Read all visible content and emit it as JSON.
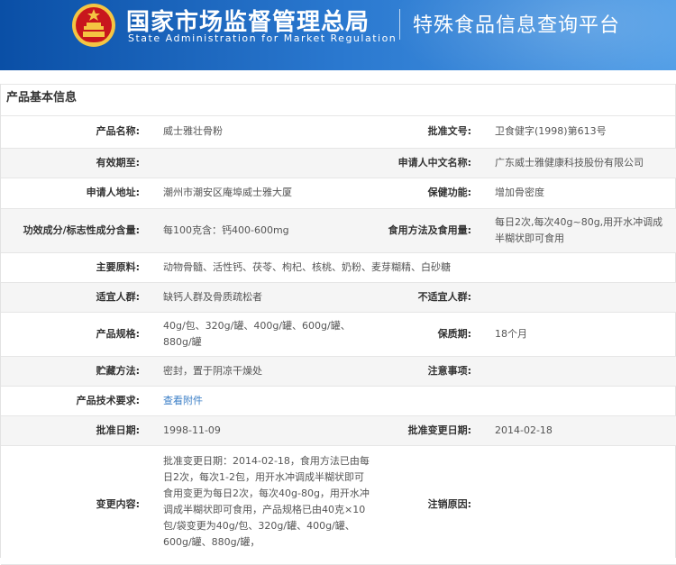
{
  "header": {
    "org_cn": "国家市场监督管理总局",
    "org_en": "State Administration  for Market Regulation",
    "platform": "特殊食品信息查询平台",
    "colors": {
      "banner_start": "#0a4fa6",
      "banner_end": "#4c9be6",
      "emblem_red": "#c8161d",
      "emblem_gold": "#f4c542"
    }
  },
  "section": {
    "title": "产品基本信息"
  },
  "rows": [
    {
      "l1": "产品名称:",
      "v1": "威士雅壮骨粉",
      "l2": "批准文号:",
      "v2": "卫食健字(1998)第613号"
    },
    {
      "l1": "有效期至:",
      "v1": "",
      "l2": "申请人中文名称:",
      "v2": "广东威士雅健康科技股份有限公司"
    },
    {
      "l1": "申请人地址:",
      "v1": "潮州市潮安区庵埠威士雅大厦",
      "l2": "保健功能:",
      "v2": "增加骨密度"
    },
    {
      "l1": "功效成分/标志性成分含量:",
      "v1": "每100克含：钙400-600mg",
      "l2": "食用方法及食用量:",
      "v2": "每日2次,每次40g~80g,用开水冲调成半糊状即可食用"
    },
    {
      "l1": "主要原料:",
      "v1": "动物骨髓、活性钙、茯苓、枸杞、核桃、奶粉、麦芽糊精、白砂糖"
    },
    {
      "l1": "适宜人群:",
      "v1": "缺钙人群及骨质疏松者",
      "l2": "不适宜人群:",
      "v2": ""
    },
    {
      "l1": "产品规格:",
      "v1": "40g/包、320g/罐、400g/罐、600g/罐、880g/罐",
      "l2": "保质期:",
      "v2": "18个月"
    },
    {
      "l1": "贮藏方法:",
      "v1": "密封，置于阴凉干燥处",
      "l2": "注意事项:",
      "v2": ""
    },
    {
      "l1": "产品技术要求:",
      "v1": "查看附件"
    },
    {
      "l1": "批准日期:",
      "v1": "1998-11-09",
      "l2": "批准变更日期:",
      "v2": "2014-02-18"
    },
    {
      "l1": "变更内容:",
      "v1": "批准变更日期：2014-02-18，食用方法已由每日2次，每次1-2包，用开水冲调成半糊状即可食用变更为每日2次，每次40g-80g，用开水冲调成半糊状即可食用，产品规格已由40克×10包/袋变更为40g/包、320g/罐、400g/罐、600g/罐、880g/罐，",
      "l2": "注销原因:",
      "v2": ""
    }
  ]
}
